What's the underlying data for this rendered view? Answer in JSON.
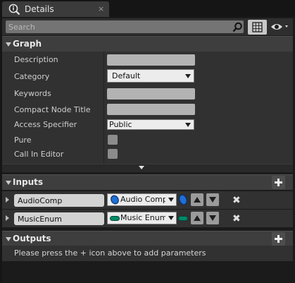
{
  "tab": {
    "title": "Details",
    "close_glyph": "×",
    "icon": "details-info-icon"
  },
  "search": {
    "placeholder": "Search",
    "icons": [
      "search-icon",
      "grid-view-icon",
      "eye-icon"
    ]
  },
  "graph": {
    "title": "Graph",
    "description_label": "Description",
    "description_value": "",
    "category_label": "Category",
    "category_value": "Default",
    "keywords_label": "Keywords",
    "keywords_value": "",
    "compact_label": "Compact Node Title",
    "compact_value": "",
    "access_label": "Access Specifier",
    "access_value": "Public",
    "pure_label": "Pure",
    "pure_checked": false,
    "call_in_editor_label": "Call In Editor",
    "call_in_editor_checked": false
  },
  "inputs": {
    "title": "Inputs",
    "params": [
      {
        "name": "AudioComp",
        "type": "Audio Component",
        "pin_color": "#1e6fd6",
        "pin_icon": "object-reference-pin-icon"
      },
      {
        "name": "MusicEnum",
        "type": "Music Enum",
        "pin_color": "#008a6a",
        "pin_icon": "enum-pin-icon"
      }
    ]
  },
  "outputs": {
    "title": "Outputs",
    "message": "Please press the + icon above to add parameters"
  },
  "colors": {
    "panel": "#313131",
    "header": "#3e3e3e",
    "background": "#1b1b1b"
  }
}
